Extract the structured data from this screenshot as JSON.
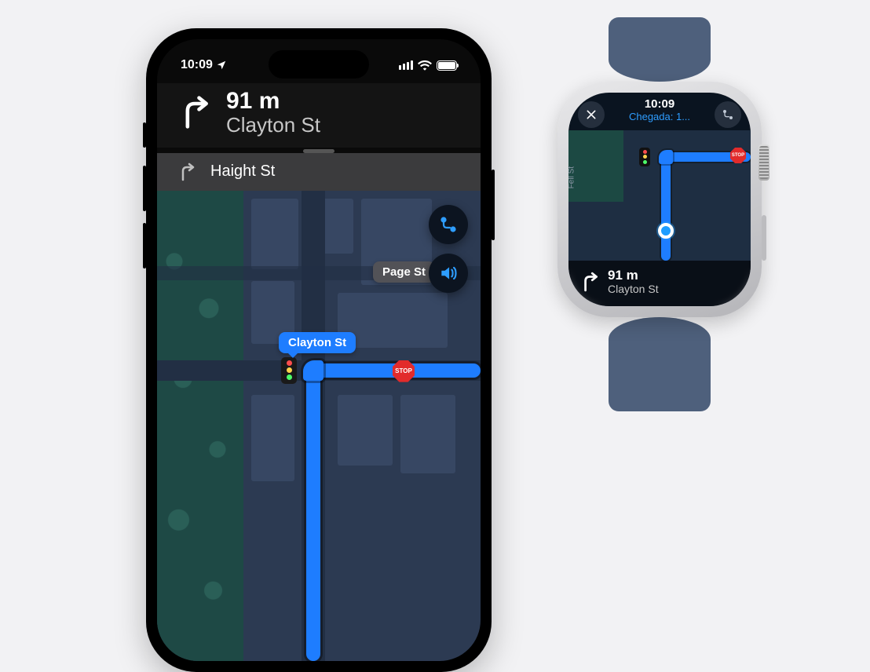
{
  "phone": {
    "status": {
      "time": "10:09"
    },
    "nav": {
      "distance": "91 m",
      "street": "Clayton St",
      "next_street": "Haight St"
    },
    "map": {
      "street_label_primary": "Clayton St",
      "street_label_secondary": "Page St",
      "stop_sign_text": "STOP"
    }
  },
  "watch": {
    "status": {
      "time": "10:09",
      "arrival": "Chegada: 1..."
    },
    "map": {
      "side_street": "Fell St",
      "stop_sign_text": "STOP"
    },
    "nav": {
      "distance": "91 m",
      "street": "Clayton St"
    }
  }
}
